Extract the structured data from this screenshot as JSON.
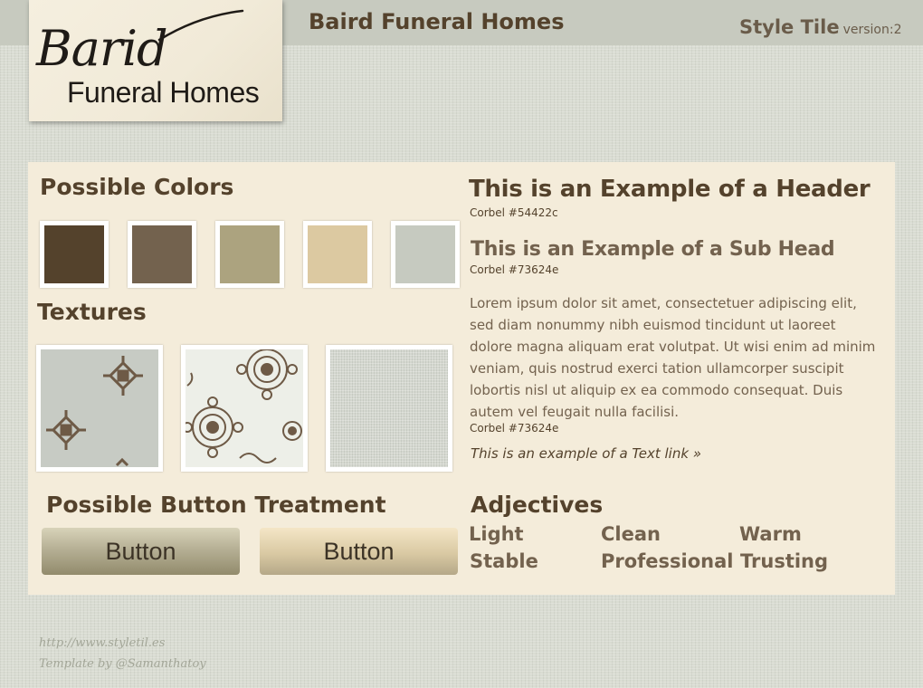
{
  "logo": {
    "script_text": "Barid",
    "subtitle": "Funeral Homes"
  },
  "header": {
    "title": "Baird Funeral Homes",
    "tile_label": "Style Tile",
    "version": "version:2"
  },
  "colors": {
    "title": "Possible Colors",
    "swatches": [
      "#54422c",
      "#73624e",
      "#aca37f",
      "#dcc9a1",
      "#c6cac0"
    ]
  },
  "textures": {
    "title": "Textures"
  },
  "buttons": {
    "title": "Possible Button Treatment",
    "labels": [
      "Button",
      "Button"
    ]
  },
  "type_examples": {
    "header": "This is an Example of a Header",
    "header_caption": "Corbel #54422c",
    "subhead": "This is an Example of a Sub Head",
    "subhead_caption": "Corbel #73624e",
    "body": "Lorem ipsum dolor sit amet, consectetuer adipiscing elit, sed diam nonummy nibh euismod tincidunt ut laoreet dolore magna aliquam erat volutpat. Ut wisi enim ad minim veniam, quis nostrud exerci tation ullamcorper suscipit lobortis nisl ut aliquip ex ea commodo consequat. Duis autem vel feugait nulla facilisi.",
    "body_caption": "Corbel #73624e",
    "link": "This is an example of a Text link »"
  },
  "adjectives": {
    "title": "Adjectives",
    "words": [
      "Light",
      "Clean",
      "Warm",
      "Stable",
      "Professional",
      "Trusting"
    ]
  },
  "footer": {
    "link": "http://www.styletil.es",
    "credit": "Template by @Samanthatoy"
  }
}
